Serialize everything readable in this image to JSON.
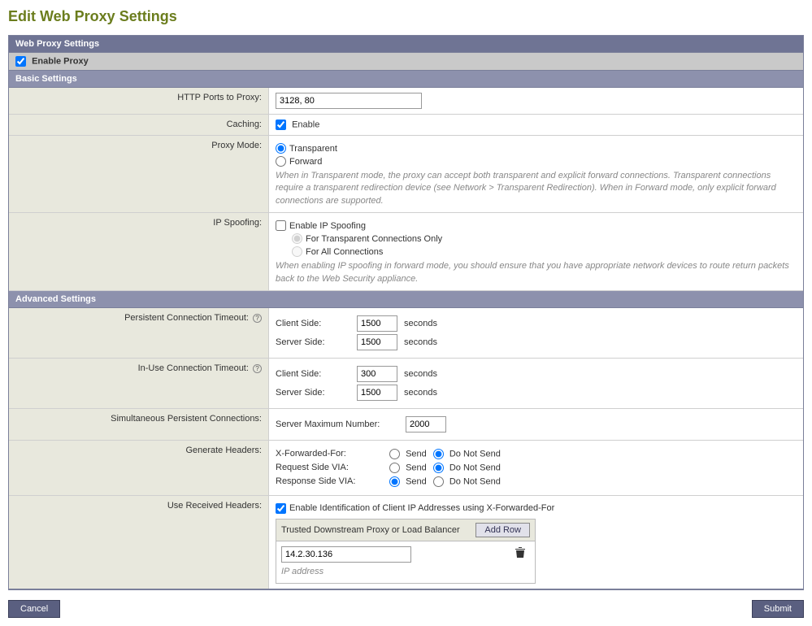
{
  "page": {
    "title": "Edit Web Proxy Settings"
  },
  "bands": {
    "settings": "Web Proxy Settings",
    "basic": "Basic Settings",
    "advanced": "Advanced Settings"
  },
  "enable_proxy": {
    "label": "Enable Proxy",
    "checked": true
  },
  "basic": {
    "http_ports": {
      "label": "HTTP Ports to Proxy:",
      "value": "3128, 80"
    },
    "caching": {
      "label": "Caching:",
      "enable_label": "Enable",
      "checked": true
    },
    "proxy_mode": {
      "label": "Proxy Mode:",
      "transparent": "Transparent",
      "forward": "Forward",
      "selected": "transparent",
      "help": "When in Transparent mode, the proxy can accept both transparent and explicit forward connections. Transparent connections require a transparent redirection device (see Network > Transparent Redirection). When in Forward mode, only explicit forward connections are supported."
    },
    "ip_spoofing": {
      "label": "IP Spoofing:",
      "enable_label": "Enable IP Spoofing",
      "checked": false,
      "opt_transparent": "For Transparent Connections Only",
      "opt_all": "For All Connections",
      "opt_selected": "transparent",
      "help": "When enabling IP spoofing in forward mode, you should ensure that you have appropriate network devices to route return packets back to the Web Security appliance."
    }
  },
  "advanced": {
    "persistent": {
      "label": "Persistent Connection Timeout:",
      "client_label": "Client Side:",
      "client_value": "1500",
      "server_label": "Server Side:",
      "server_value": "1500",
      "unit": "seconds"
    },
    "inuse": {
      "label": "In-Use Connection Timeout:",
      "client_label": "Client Side:",
      "client_value": "300",
      "server_label": "Server Side:",
      "server_value": "1500",
      "unit": "seconds"
    },
    "simultaneous": {
      "label": "Simultaneous Persistent Connections:",
      "server_max_label": "Server Maximum Number:",
      "value": "2000"
    },
    "headers": {
      "label": "Generate Headers:",
      "send": "Send",
      "do_not_send": "Do Not Send",
      "xff": {
        "label": "X-Forwarded-For:",
        "selected": "do_not_send"
      },
      "req_via": {
        "label": "Request Side VIA:",
        "selected": "do_not_send"
      },
      "resp_via": {
        "label": "Response Side VIA:",
        "selected": "send"
      }
    },
    "received": {
      "label": "Use Received Headers:",
      "enable_label": "Enable Identification of Client IP Addresses using X-Forwarded-For",
      "checked": true,
      "trusted_header": "Trusted Downstream Proxy or Load Balancer",
      "add_row": "Add Row",
      "ip_value": "14.2.30.136",
      "ip_caption": "IP address"
    }
  },
  "buttons": {
    "cancel": "Cancel",
    "submit": "Submit"
  }
}
